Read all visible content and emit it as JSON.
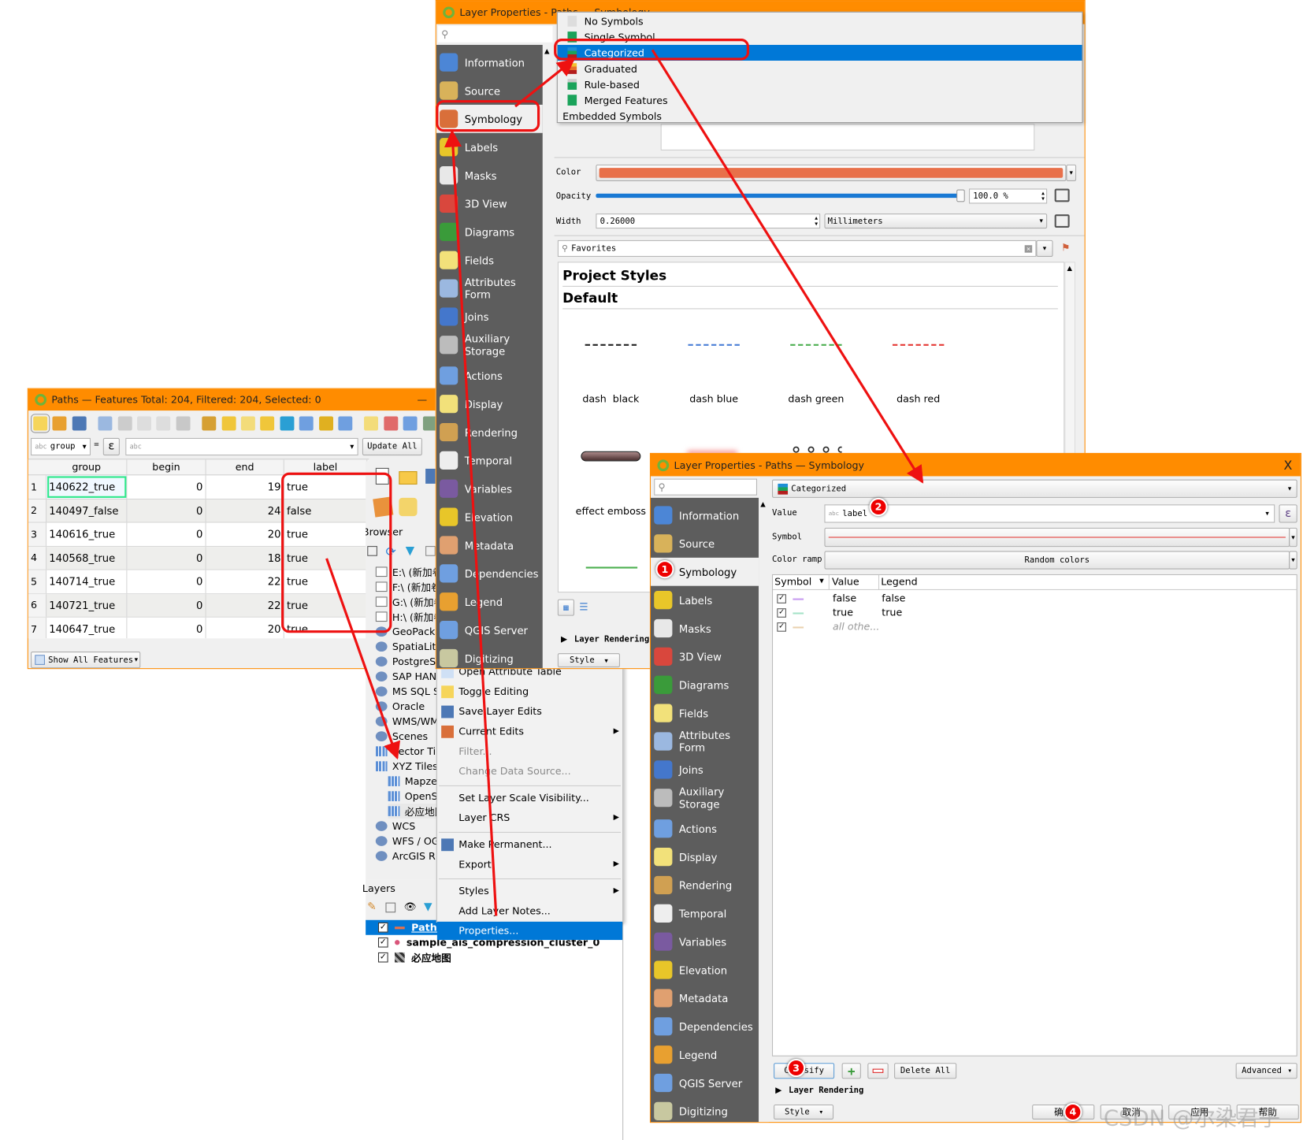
{
  "colors": {
    "title_bar": "#ff8c00",
    "selection": "#0078d7",
    "sidebar": "#5d5d5d",
    "annotation": "#ee1111",
    "symbol_color": "#e8704a"
  },
  "props_top": {
    "title": "Layer Properties - Paths — Symbology",
    "sidebar": [
      "Information",
      "Source",
      "Symbology",
      "Labels",
      "Masks",
      "3D View",
      "Diagrams",
      "Fields",
      "Attributes Form",
      "Joins",
      "Auxiliary Storage",
      "Actions",
      "Display",
      "Rendering",
      "Temporal",
      "Variables",
      "Elevation",
      "Metadata",
      "Dependencies",
      "Legend",
      "QGIS Server",
      "Digitizing"
    ],
    "selected": "Symbology",
    "renderer_menu": [
      {
        "label": "No Symbols",
        "icon": "no-symbols-icon"
      },
      {
        "label": "Single Symbol",
        "icon": "single-symbol-icon"
      },
      {
        "label": "Categorized",
        "icon": "categorized-icon",
        "selected": true
      },
      {
        "label": "Graduated",
        "icon": "graduated-icon"
      },
      {
        "label": "Rule-based",
        "icon": "rule-based-icon"
      },
      {
        "label": "Merged Features",
        "icon": "merged-features-icon"
      },
      {
        "label": "Embedded Symbols"
      }
    ],
    "color_label": "Color",
    "opacity_label": "Opacity",
    "opacity_value": "100.0 %",
    "opacity": 1.0,
    "width_label": "Width",
    "width_value": "0.26000",
    "unit": "Millimeters",
    "favorites": "Favorites",
    "project_styles": "Project Styles",
    "default": "Default",
    "styles": [
      {
        "name": "dash  black",
        "color": "#222222"
      },
      {
        "name": "dash blue",
        "color": "#4a7fd6"
      },
      {
        "name": "dash green",
        "color": "#4caf50"
      },
      {
        "name": "dash red",
        "color": "#e53935"
      },
      {
        "name": "effect emboss"
      }
    ],
    "layer_rendering": "Layer Rendering",
    "style_btn": "Style"
  },
  "attr_table": {
    "title": "Paths — Features Total: 204, Filtered: 204, Selected: 0",
    "minimize": "—",
    "filter_field": "group",
    "filter_field_type": "abc",
    "eq": "=",
    "epsilon": "ε",
    "filter_placeholder": "abc",
    "update_all": "Update All",
    "columns": [
      "group",
      "begin",
      "end",
      "label"
    ],
    "rows": [
      [
        "1",
        "140622_true",
        "0",
        "19",
        "true"
      ],
      [
        "2",
        "140497_false",
        "0",
        "24",
        "false"
      ],
      [
        "3",
        "140616_true",
        "0",
        "20",
        "true"
      ],
      [
        "4",
        "140568_true",
        "0",
        "18",
        "true"
      ],
      [
        "5",
        "140714_true",
        "0",
        "22",
        "true"
      ],
      [
        "6",
        "140721_true",
        "0",
        "22",
        "true"
      ],
      [
        "7",
        "140647_true",
        "0",
        "20",
        "true"
      ]
    ],
    "show_all": "Show All Features"
  },
  "browser": {
    "title": "Browser",
    "items": [
      "E:\\ (新加卷",
      "F:\\ (新加卷",
      "G:\\ (新加卷",
      "H:\\ (新加卷",
      "GeoPackage",
      "SpatiaLite",
      "PostgreSQL",
      "SAP HANA",
      "MS SQL Server",
      "Oracle",
      "WMS/WMTS",
      "Scenes",
      "Vector Tiles",
      "XYZ Tiles",
      "Mapzen",
      "OpenStreetMap",
      "必应地图",
      "WCS",
      "WFS / OGC",
      "ArcGIS REST"
    ]
  },
  "layers": {
    "title": "Layers",
    "items": [
      {
        "name": "Paths",
        "checked": true,
        "selected": true
      },
      {
        "name": "sample_ais_compression_cluster_0",
        "checked": true
      },
      {
        "name": "必应地图",
        "checked": true
      }
    ]
  },
  "context_menu": [
    {
      "label": "Open Attribute Table"
    },
    {
      "label": "Toggle Editing"
    },
    {
      "label": "Save Layer Edits"
    },
    {
      "label": "Current Edits",
      "sub": true
    },
    {
      "label": "Filter...",
      "disabled": true
    },
    {
      "label": "Change Data Source...",
      "disabled": true
    },
    {
      "sep": true
    },
    {
      "label": "Set Layer Scale Visibility..."
    },
    {
      "label": "Layer CRS",
      "sub": true
    },
    {
      "sep": true
    },
    {
      "label": "Make Permanent..."
    },
    {
      "label": "Export",
      "sub": true
    },
    {
      "sep": true
    },
    {
      "label": "Styles",
      "sub": true
    },
    {
      "label": "Add Layer Notes..."
    },
    {
      "label": "Properties...",
      "selected": true
    }
  ],
  "props_main": {
    "title": "Layer Properties - Paths — Symbology",
    "close": "X",
    "sidebar": [
      "Information",
      "Source",
      "Symbology",
      "Labels",
      "Masks",
      "3D View",
      "Diagrams",
      "Fields",
      "Attributes Form",
      "Joins",
      "Auxiliary Storage",
      "Actions",
      "Display",
      "Rendering",
      "Temporal",
      "Variables",
      "Elevation",
      "Metadata",
      "Dependencies",
      "Legend",
      "QGIS Server",
      "Digitizing"
    ],
    "selected": "Symbology",
    "renderer": "Categorized",
    "value_label": "Value",
    "value_type": "abc",
    "value": "label",
    "epsilon": "ε",
    "symbol_label": "Symbol",
    "color_ramp_label": "Color ramp",
    "color_ramp": "Random colors",
    "columns": [
      "Symbol",
      "Value",
      "Legend"
    ],
    "categories": [
      {
        "value": "false",
        "legend": "false",
        "color": "#c89bf0",
        "checked": true
      },
      {
        "value": "true",
        "legend": "true",
        "color": "#a6e3c8",
        "checked": true
      },
      {
        "value": "all othe...",
        "legend": "",
        "color": "#ead2b0",
        "checked": true,
        "other": true
      }
    ],
    "classify": "Classify",
    "delete_all": "Delete All",
    "advanced": "Advanced",
    "layer_rendering": "Layer Rendering",
    "style_btn": "Style",
    "ok": "确定",
    "cancel": "取消",
    "apply": "应用",
    "help": "帮助"
  },
  "badges": [
    "1",
    "2",
    "3",
    "4"
  ],
  "watermark": "CSDN @尔染君子"
}
